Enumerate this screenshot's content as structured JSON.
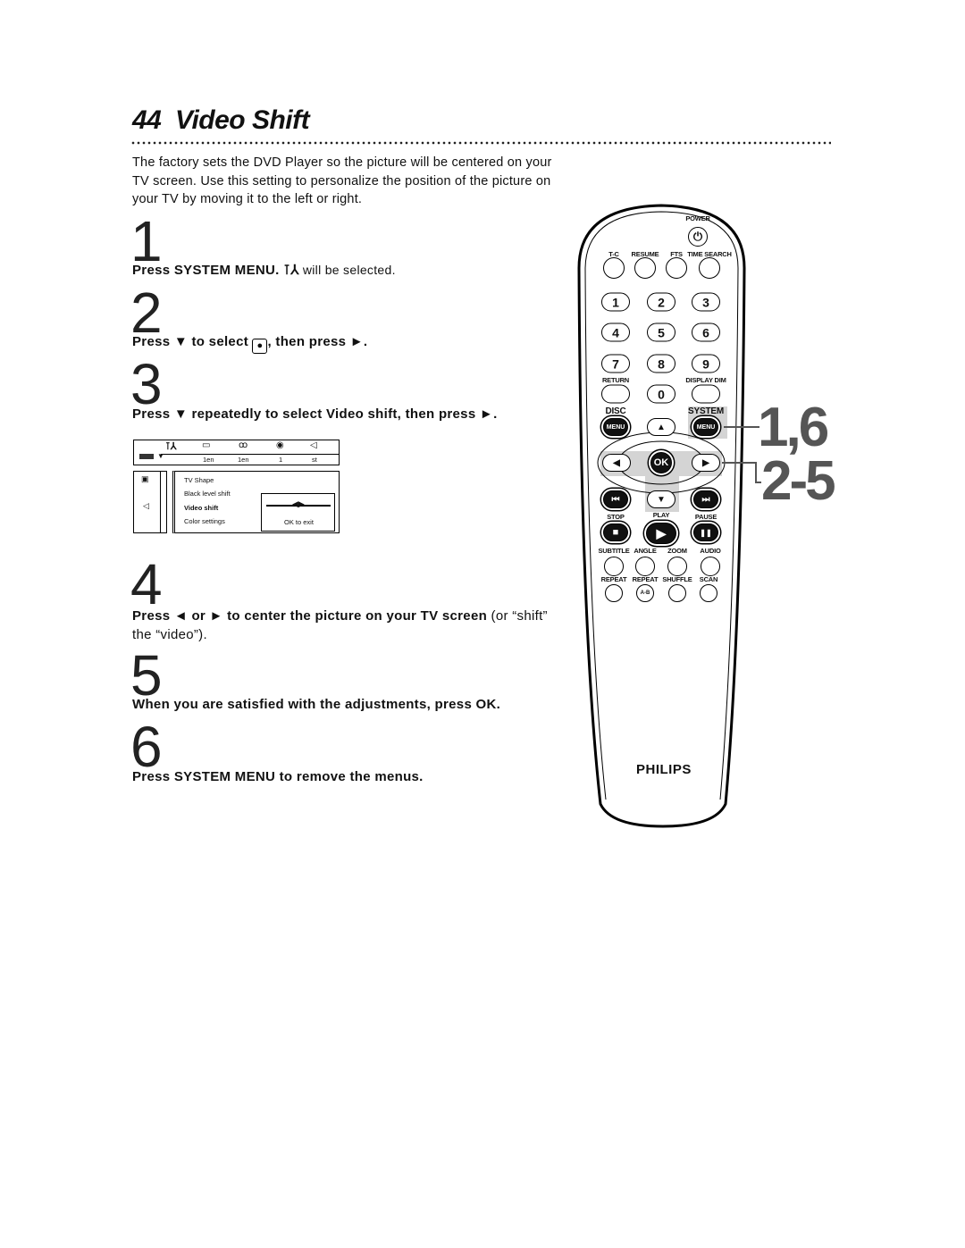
{
  "page": {
    "number": "44",
    "title": "Video Shift"
  },
  "intro": "The factory sets the DVD Player so the picture will be centered on your TV screen. Use this setting to personalize the position of the picture on your TV by moving it to the left or right.",
  "steps": [
    {
      "n": "1",
      "bold": "Press SYSTEM MENU.",
      "normal": " will be selected."
    },
    {
      "n": "2",
      "bold": "Press ▼ to select",
      "bold2": ", then press ►."
    },
    {
      "n": "3",
      "bold": "Press ▼ repeatedly to select Video shift, then press ►."
    },
    {
      "n": "4",
      "bold": "Press ◄ or ► to center the picture on your TV screen",
      "normal": " (or “shift” the “video”)."
    },
    {
      "n": "5",
      "bold": "When you are satisfied with the adjustments, press OK."
    },
    {
      "n": "6",
      "bold": "Press SYSTEM MENU to remove the menus."
    }
  ],
  "osd": {
    "top_values": [
      "1en",
      "1en",
      "1",
      "st"
    ],
    "items": [
      "TV Shape",
      "Black level shift",
      "Video shift",
      "Color settings"
    ],
    "selected": "Video shift",
    "ok_text": "OK to exit"
  },
  "remote": {
    "brand": "PHILIPS",
    "labels": {
      "power": "POWER",
      "tc": "T-C",
      "resume": "RESUME",
      "fts": "FTS",
      "time_search": "TIME SEARCH",
      "return": "RETURN",
      "display_dim": "DISPLAY DIM",
      "disc": "DISC",
      "system": "SYSTEM",
      "stop": "STOP",
      "play": "PLAY",
      "pause": "PAUSE",
      "subtitle": "SUBTITLE",
      "angle": "ANGLE",
      "zoom": "ZOOM",
      "audio": "AUDIO",
      "repeat": "REPEAT",
      "repeat_ab": "REPEAT",
      "shuffle": "SHUFFLE",
      "scan": "SCAN"
    },
    "digits": [
      "1",
      "2",
      "3",
      "4",
      "5",
      "6",
      "7",
      "8",
      "9",
      "0"
    ],
    "menu_btn": "MENU",
    "ok_btn": "OK",
    "ab_btn": "A-B"
  },
  "callouts": [
    "1,6",
    "2-5"
  ]
}
